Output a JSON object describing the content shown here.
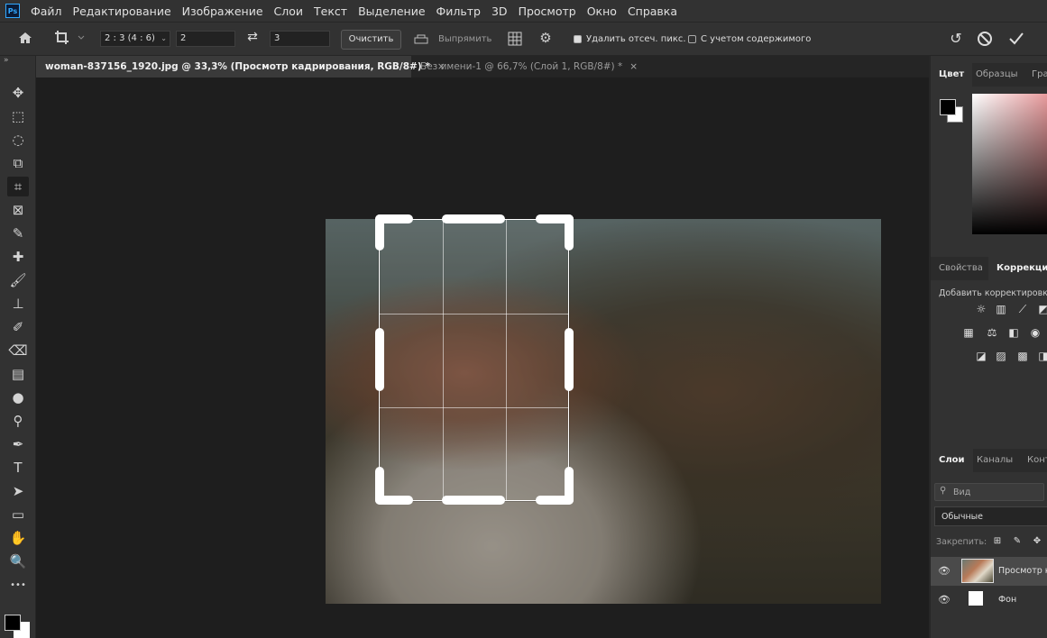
{
  "app": {
    "logo": "Ps"
  },
  "menu": [
    "Файл",
    "Редактирование",
    "Изображение",
    "Слои",
    "Текст",
    "Выделение",
    "Фильтр",
    "3D",
    "Просмотр",
    "Окно",
    "Справка"
  ],
  "options": {
    "ratio_preset": "2 : 3 (4 : 6)",
    "width_value": "2",
    "height_value": "3",
    "clear_label": "Очистить",
    "straighten_label": "Выпрямить",
    "delete_cropped_label": "Удалить отсеч. пикс.",
    "delete_cropped_checked": true,
    "content_aware_label": "С учетом содержимого",
    "content_aware_checked": false
  },
  "tabs": [
    {
      "label": "woman-837156_1920.jpg @ 33,3% (Просмотр кадрирования, RGB/8#) *",
      "active": true
    },
    {
      "label": "Без имени-1 @ 66,7% (Слой 1, RGB/8#) *",
      "active": false
    }
  ],
  "tools": [
    "move-icon",
    "marquee-icon",
    "lasso-icon",
    "object-select-icon",
    "crop-icon",
    "frame-icon",
    "eyedropper-icon",
    "healing-icon",
    "brush-icon",
    "stamp-icon",
    "history-brush-icon",
    "eraser-icon",
    "gradient-icon",
    "blur-icon",
    "dodge-icon",
    "pen-icon",
    "type-icon",
    "path-select-icon",
    "rectangle-icon",
    "hand-icon",
    "zoom-icon",
    "more-icon"
  ],
  "tool_glyphs": [
    "✥",
    "⬚",
    "◌",
    "⧉",
    "⌗",
    "⊠",
    "✎",
    "✚",
    "🖌",
    "⊥",
    "✐",
    "⌫",
    "▤",
    "●",
    "⚲",
    "✒",
    "T",
    "➤",
    "▭",
    "✋",
    "🔍",
    "•••"
  ],
  "panels": {
    "color_tabs": [
      "Цвет",
      "Образцы",
      "Гра"
    ],
    "props_tabs": [
      "Свойства",
      "Коррекция"
    ],
    "add_adjustment": "Добавить корректировку",
    "layers_tabs": [
      "Слои",
      "Каналы",
      "Конт"
    ],
    "search_placeholder": "Вид",
    "blend_mode": "Обычные",
    "lock_label": "Закрепить:",
    "layers": [
      {
        "name": "Просмотр к"
      },
      {
        "name": "Фон"
      }
    ]
  },
  "colors": {
    "accent": "#31a8ff",
    "foreground": "#000000",
    "background": "#ffffff"
  }
}
